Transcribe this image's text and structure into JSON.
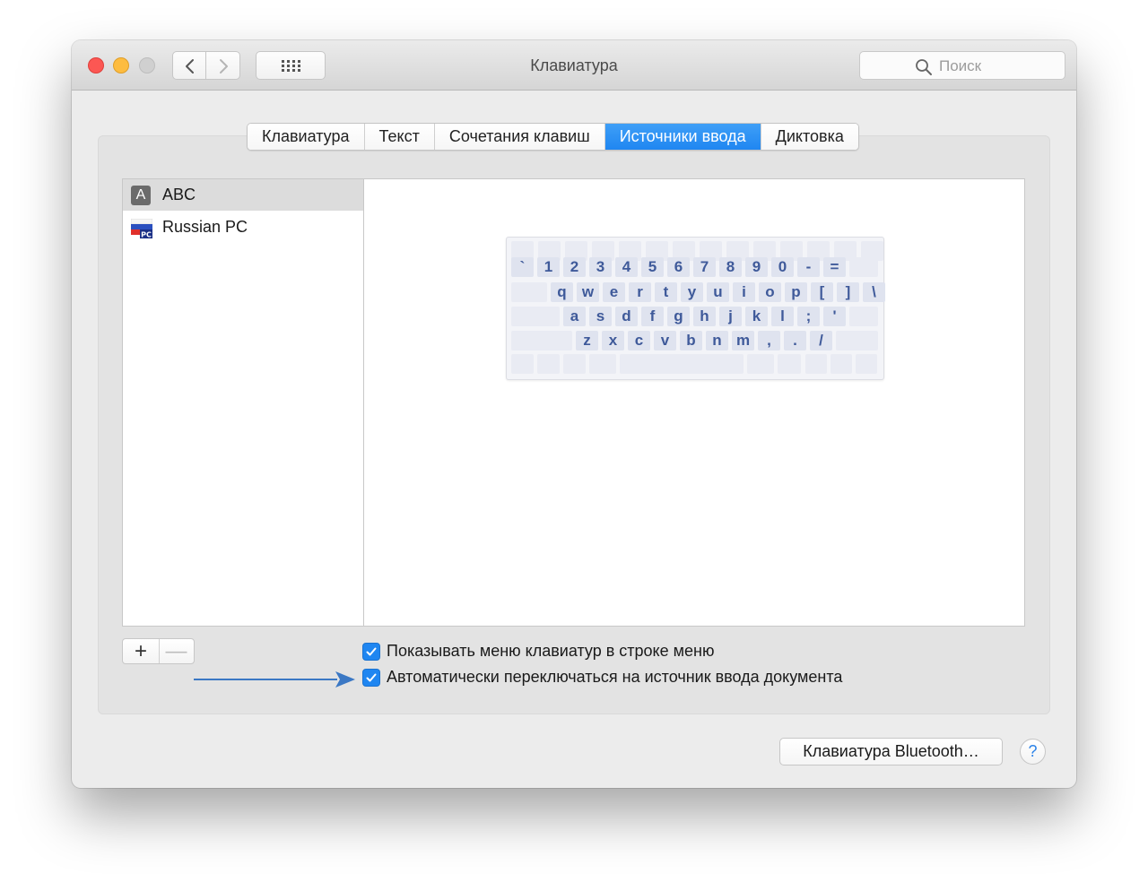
{
  "window": {
    "title": "Клавиатура",
    "search_placeholder": "Поиск"
  },
  "tabs": [
    {
      "label": "Клавиатура",
      "active": false
    },
    {
      "label": "Текст",
      "active": false
    },
    {
      "label": "Сочетания клавиш",
      "active": false
    },
    {
      "label": "Источники ввода",
      "active": true
    },
    {
      "label": "Диктовка",
      "active": false
    }
  ],
  "input_sources": [
    {
      "label": "ABC",
      "icon": "abc-icon",
      "icon_letter": "A",
      "selected": true
    },
    {
      "label": "Russian PC",
      "icon": "russian-flag-icon",
      "icon_text": "PC",
      "selected": false
    }
  ],
  "keyboard_rows": [
    [
      "`",
      "1",
      "2",
      "3",
      "4",
      "5",
      "6",
      "7",
      "8",
      "9",
      "0",
      "-",
      "="
    ],
    [
      "q",
      "w",
      "e",
      "r",
      "t",
      "y",
      "u",
      "i",
      "o",
      "p",
      "[",
      "]",
      "\\"
    ],
    [
      "a",
      "s",
      "d",
      "f",
      "g",
      "h",
      "j",
      "k",
      "l",
      ";",
      "'"
    ],
    [
      "z",
      "x",
      "c",
      "v",
      "b",
      "n",
      "m",
      ",",
      ".",
      "/"
    ]
  ],
  "list_controls": {
    "add": "+",
    "remove": "—"
  },
  "options": [
    {
      "label": "Показывать меню клавиатур в строке меню",
      "checked": true
    },
    {
      "label": "Автоматически переключаться на источник ввода документа",
      "checked": true
    }
  ],
  "bluetooth_button": "Клавиатура Bluetooth…",
  "help_button": "?",
  "colors": {
    "accent": "#1f86f1",
    "arrow": "#3b78c4",
    "key_text": "#3f5a9a"
  }
}
